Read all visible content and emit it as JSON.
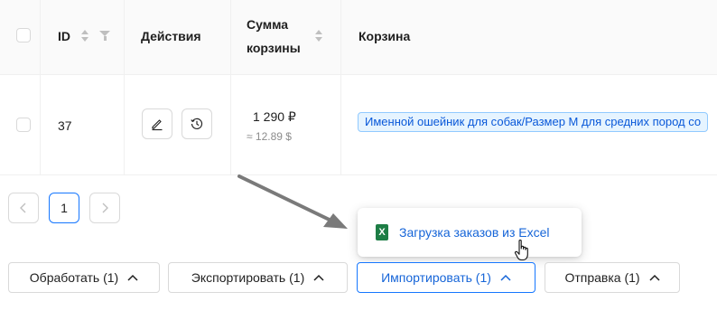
{
  "table": {
    "columns": {
      "id": "ID",
      "actions": "Действия",
      "sum_line1": "Сумма",
      "sum_line2": "корзины",
      "cart": "Корзина"
    },
    "rows": [
      {
        "id": "37",
        "sum": "1 290 ₽",
        "sum_usd": "≈ 12.89 $",
        "cart_tag": "Именной ошейник для собак/Размер М для средних пород со"
      }
    ]
  },
  "pagination": {
    "current_page": "1"
  },
  "dropdown": {
    "item_label": "Загрузка заказов из Excel",
    "item_icon": "excel-icon",
    "item_icon_letter": "X"
  },
  "actions_bar": {
    "process": "Обработать (1)",
    "export": "Экспортировать (1)",
    "import": "Импортировать (1)",
    "shipping": "Отправка (1)"
  },
  "colors": {
    "accent": "#1677ff",
    "tag_bg": "#e6f4ff",
    "excel_green": "#1d7d45"
  }
}
